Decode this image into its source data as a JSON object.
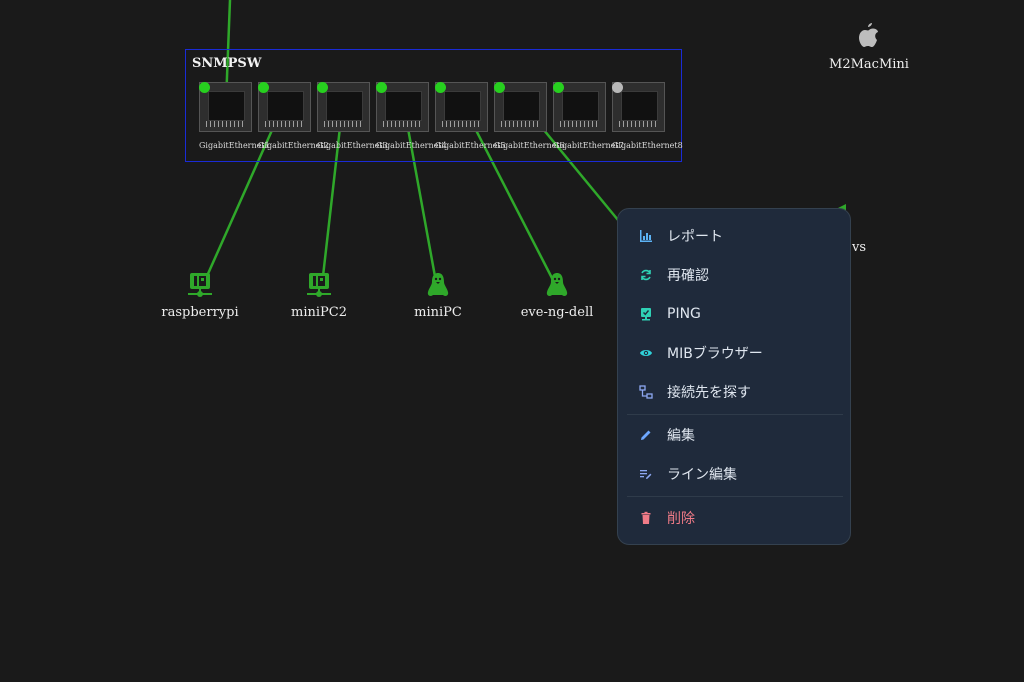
{
  "colors": {
    "background": "#1a1a1a",
    "link": "#2fa82a",
    "led_on": "#27d01f",
    "led_off": "#b8b8b8",
    "switch_border": "#1a2bd6",
    "node_icon": "#2fa82a",
    "menu_bg": "#1f2a3b",
    "menu_icon": "#5cb3f5",
    "danger": "#f07b87"
  },
  "switch": {
    "name": "SNMPSW",
    "ports": [
      {
        "label": "GigabitEthernet1",
        "status": "up"
      },
      {
        "label": "GigabitEthernet2",
        "status": "up"
      },
      {
        "label": "GigabitEthernet3",
        "status": "up"
      },
      {
        "label": "GigabitEthernet4",
        "status": "up"
      },
      {
        "label": "GigabitEthernet5",
        "status": "up"
      },
      {
        "label": "GigabitEthernet6",
        "status": "up"
      },
      {
        "label": "GigabitEthernet7",
        "status": "up"
      },
      {
        "label": "GigabitEthernet8",
        "status": "down"
      }
    ]
  },
  "nodes": {
    "raspberrypi": {
      "name": "raspberrypi",
      "icon": "ip-device-icon"
    },
    "minipc2": {
      "name": "miniPC2",
      "icon": "ip-device-icon"
    },
    "minipc": {
      "name": "miniPC",
      "icon": "linux-icon"
    },
    "eveng": {
      "name": "eve-ng-dell",
      "icon": "linux-icon"
    },
    "mac": {
      "name": "M2MacMini",
      "icon": "apple-icon"
    },
    "partial": {
      "name_fragment": "vs"
    }
  },
  "menu": {
    "items": [
      {
        "label": "レポート",
        "icon": "chart-icon"
      },
      {
        "label": "再確認",
        "icon": "refresh-icon"
      },
      {
        "label": "PING",
        "icon": "ping-icon"
      },
      {
        "label": "MIBブラウザー",
        "icon": "eye-icon"
      },
      {
        "label": "接続先を探す",
        "icon": "connection-icon"
      },
      {
        "label": "編集",
        "icon": "pencil-icon"
      },
      {
        "label": "ライン編集",
        "icon": "line-edit-icon"
      },
      {
        "label": "削除",
        "icon": "trash-icon"
      }
    ]
  }
}
